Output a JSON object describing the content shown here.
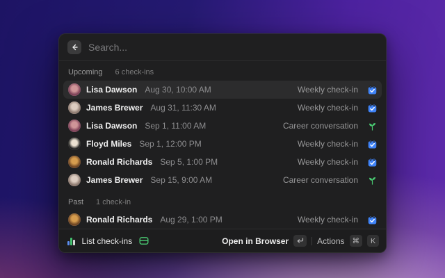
{
  "search": {
    "placeholder": "Search..."
  },
  "sections": [
    {
      "label": "Upcoming",
      "count_label": "6 check-ins",
      "rows": [
        {
          "name": "Lisa Dawson",
          "datetime": "Aug 30, 10:00 AM",
          "type": "Weekly check-in",
          "icon": "calendar-check",
          "selected": true,
          "avatar": [
            "#7e4258",
            "#cf9598"
          ]
        },
        {
          "name": "James Brewer",
          "datetime": "Aug 31, 11:30 AM",
          "type": "Weekly check-in",
          "icon": "calendar-check",
          "selected": false,
          "avatar": [
            "#8d7a70",
            "#dcccc0"
          ]
        },
        {
          "name": "Lisa Dawson",
          "datetime": "Sep 1, 11:00 AM",
          "type": "Career conversation",
          "icon": "seedling",
          "selected": false,
          "avatar": [
            "#7e4258",
            "#cf9598"
          ]
        },
        {
          "name": "Floyd Miles",
          "datetime": "Sep 1, 12:00 PM",
          "type": "Weekly check-in",
          "icon": "calendar-check",
          "selected": false,
          "avatar": [
            "#222221",
            "#ece2d2"
          ]
        },
        {
          "name": "Ronald Richards",
          "datetime": "Sep 5, 1:00 PM",
          "type": "Weekly check-in",
          "icon": "calendar-check",
          "selected": false,
          "avatar": [
            "#6e4523",
            "#d59c4e"
          ]
        },
        {
          "name": "James Brewer",
          "datetime": "Sep 15, 9:00 AM",
          "type": "Career conversation",
          "icon": "seedling",
          "selected": false,
          "avatar": [
            "#8d7a70",
            "#dcccc0"
          ]
        }
      ]
    },
    {
      "label": "Past",
      "count_label": "1 check-in",
      "rows": [
        {
          "name": "Ronald Richards",
          "datetime": "Aug 29, 1:00 PM",
          "type": "Weekly check-in",
          "icon": "calendar-check",
          "selected": false,
          "avatar": [
            "#6e4523",
            "#d59c4e"
          ]
        }
      ]
    }
  ],
  "footer": {
    "command_label": "List check-ins",
    "open_label": "Open in Browser",
    "actions_label": "Actions",
    "actions_keys": [
      "⌘",
      "K"
    ]
  },
  "colors": {
    "accent_blue": "#3f83f8",
    "accent_green": "#49c871"
  }
}
